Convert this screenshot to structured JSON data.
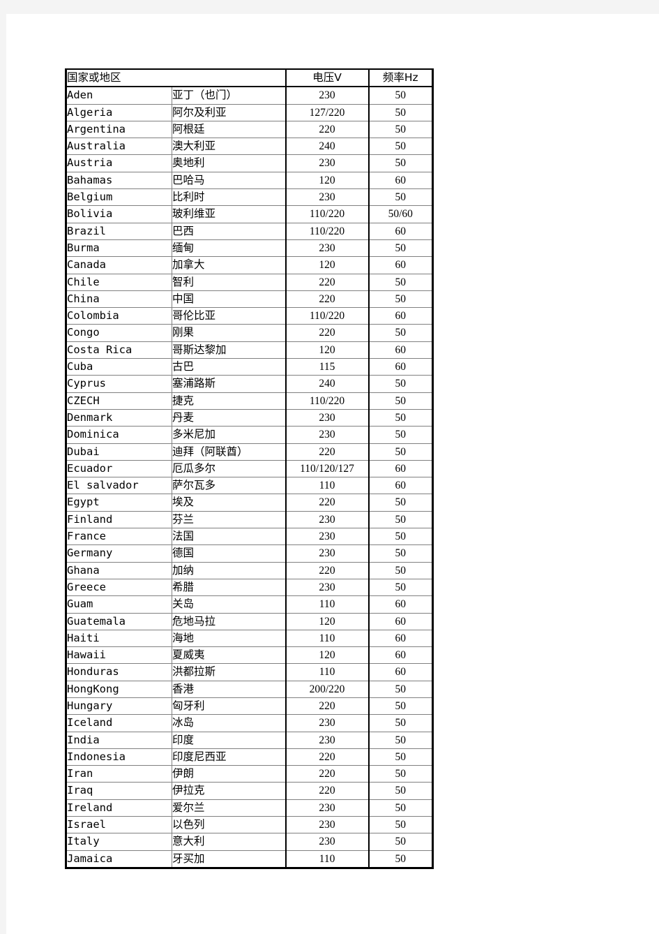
{
  "table": {
    "headers": {
      "country": "国家或地区",
      "voltage": "电压V",
      "frequency": "频率Hz"
    },
    "rows": [
      {
        "en": "Aden",
        "zh": "亚丁（也门）",
        "v": "230",
        "f": "50"
      },
      {
        "en": "Algeria",
        "zh": "阿尔及利亚",
        "v": "127/220",
        "f": "50"
      },
      {
        "en": "Argentina",
        "zh": "阿根廷",
        "v": "220",
        "f": "50"
      },
      {
        "en": "Australia",
        "zh": "澳大利亚",
        "v": "240",
        "f": "50"
      },
      {
        "en": "Austria",
        "zh": "奥地利",
        "v": "230",
        "f": "50"
      },
      {
        "en": "Bahamas",
        "zh": "巴哈马",
        "v": "120",
        "f": "60"
      },
      {
        "en": "Belgium",
        "zh": "比利时",
        "v": "230",
        "f": "50"
      },
      {
        "en": "Bolivia",
        "zh": "玻利维亚",
        "v": "110/220",
        "f": "50/60"
      },
      {
        "en": "Brazil",
        "zh": "巴西",
        "v": "110/220",
        "f": "60"
      },
      {
        "en": "Burma",
        "zh": "缅甸",
        "v": "230",
        "f": "50"
      },
      {
        "en": "Canada",
        "zh": "加拿大",
        "v": "120",
        "f": "60"
      },
      {
        "en": "Chile",
        "zh": "智利",
        "v": "220",
        "f": "50"
      },
      {
        "en": "China",
        "zh": "中国",
        "v": "220",
        "f": "50"
      },
      {
        "en": "Colombia",
        "zh": "哥伦比亚",
        "v": "110/220",
        "f": "60"
      },
      {
        "en": "Congo",
        "zh": "刚果",
        "v": "220",
        "f": "50"
      },
      {
        "en": "Costa Rica",
        "zh": "哥斯达黎加",
        "v": "120",
        "f": "60"
      },
      {
        "en": "Cuba",
        "zh": "古巴",
        "v": "115",
        "f": "60"
      },
      {
        "en": "Cyprus",
        "zh": "塞浦路斯",
        "v": "240",
        "f": "50"
      },
      {
        "en": "CZECH",
        "zh": "捷克",
        "v": "110/220",
        "f": "50"
      },
      {
        "en": "Denmark",
        "zh": "丹麦",
        "v": "230",
        "f": "50"
      },
      {
        "en": "Dominica",
        "zh": "多米尼加",
        "v": "230",
        "f": "50"
      },
      {
        "en": "Dubai",
        "zh": "迪拜（阿联酋）",
        "v": "220",
        "f": "50"
      },
      {
        "en": "Ecuador",
        "zh": "厄瓜多尔",
        "v": "110/120/127",
        "f": "60"
      },
      {
        "en": "El salvador",
        "zh": "萨尔瓦多",
        "v": "110",
        "f": "60"
      },
      {
        "en": "Egypt",
        "zh": "埃及",
        "v": "220",
        "f": "50"
      },
      {
        "en": "Finland",
        "zh": "芬兰",
        "v": "230",
        "f": "50"
      },
      {
        "en": "France",
        "zh": "法国",
        "v": "230",
        "f": "50"
      },
      {
        "en": "Germany",
        "zh": "德国",
        "v": "230",
        "f": "50"
      },
      {
        "en": "Ghana",
        "zh": "加纳",
        "v": "220",
        "f": "50"
      },
      {
        "en": "Greece",
        "zh": "希腊",
        "v": "230",
        "f": "50"
      },
      {
        "en": "Guam",
        "zh": "关岛",
        "v": "110",
        "f": "60"
      },
      {
        "en": "Guatemala",
        "zh": "危地马拉",
        "v": "120",
        "f": "60"
      },
      {
        "en": "Haiti",
        "zh": "海地",
        "v": "110",
        "f": "60"
      },
      {
        "en": "Hawaii",
        "zh": "夏威夷",
        "v": "120",
        "f": "60"
      },
      {
        "en": "Honduras",
        "zh": "洪都拉斯",
        "v": "110",
        "f": "60"
      },
      {
        "en": "HongKong",
        "zh": "香港",
        "v": "200/220",
        "f": "50"
      },
      {
        "en": "Hungary",
        "zh": "匈牙利",
        "v": "220",
        "f": "50"
      },
      {
        "en": "Iceland",
        "zh": "冰岛",
        "v": "230",
        "f": "50"
      },
      {
        "en": "India",
        "zh": "印度",
        "v": "230",
        "f": "50"
      },
      {
        "en": "Indonesia",
        "zh": "印度尼西亚",
        "v": "220",
        "f": "50"
      },
      {
        "en": "Iran",
        "zh": "伊朗",
        "v": "220",
        "f": "50"
      },
      {
        "en": "Iraq",
        "zh": "伊拉克",
        "v": "220",
        "f": "50"
      },
      {
        "en": "Ireland",
        "zh": "爱尔兰",
        "v": "230",
        "f": "50"
      },
      {
        "en": "Israel",
        "zh": "以色列",
        "v": "230",
        "f": "50"
      },
      {
        "en": "Italy",
        "zh": "意大利",
        "v": "230",
        "f": "50"
      },
      {
        "en": "Jamaica",
        "zh": "牙买加",
        "v": "110",
        "f": "50"
      }
    ]
  }
}
